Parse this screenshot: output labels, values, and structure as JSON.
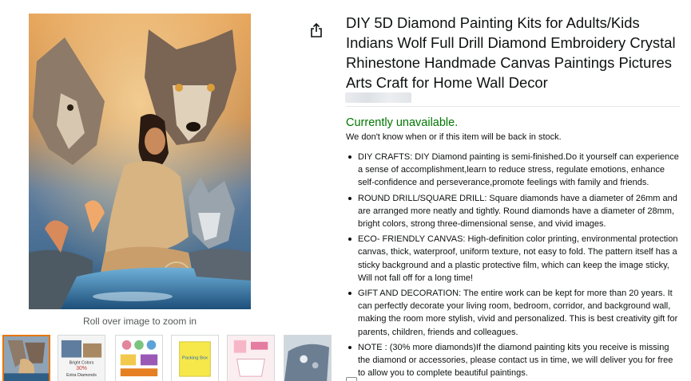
{
  "product": {
    "title": "DIY 5D Diamond Painting Kits for Adults/Kids Indians Wolf Full Drill Diamond Embroidery Crystal Rhinestone Handmade Canvas Paintings Pictures Arts Craft for Home Wall Decor",
    "availability": "Currently unavailable.",
    "availability_note": "We don't know when or if this item will be back in stock.",
    "bullets": [
      "DIY CRAFTS: DIY Diamond painting is semi-finished.Do it yourself can experience a sense of accomplishment,learn to reduce stress, regulate emotions, enhance self-confidence and perseverance,promote feelings with family and friends.",
      "ROUND DRILL/SQUARE DRILL: Square diamonds have a diameter of 26mm and are arranged more neatly and tightly. Round diamonds have a diameter of 28mm, bright colors, strong three-dimensional sense, and vivid images.",
      "ECO- FRIENDLY CANVAS: High-definition color printing, environmental protection canvas, thick, waterproof, uniform texture, not easy to fold. The pattern itself has a sticky background and a plastic protective film, which can keep the image sticky, Will not fall off for a long time!",
      "GIFT AND DECORATION: The entire work can be kept for more than 20 years. It can perfectly decorate your living room, bedroom, corridor, and background wall, making the room more stylish, vivid and personalized. This is best creativity gift for parents, children, friends and colleagues.",
      "NOTE : (30% more diamonds)If the diamond painting kits you receive is missing the diamond or accessories, please contact us in time, we will deliver you for free to allow you to complete beautiful paintings."
    ]
  },
  "gallery": {
    "zoom_hint": "Roll over image to zoom in",
    "thumbnails": [
      {
        "label": "main image",
        "selected": true
      },
      {
        "label": "Bright Colors 30% Extra Diamonds",
        "text_lines": [
          "Bright Colors",
          "30%",
          "Extra Diamonds"
        ]
      },
      {
        "label": "drill samples"
      },
      {
        "label": "Packing box",
        "text_lines": [
          "Packing Box"
        ]
      },
      {
        "label": "tools"
      },
      {
        "label": "detail"
      }
    ]
  },
  "icons": {
    "share": "share-icon"
  },
  "colors": {
    "availability": "#007600",
    "selected_thumb_border": "#e77600",
    "text": "#0f1111",
    "muted": "#565959"
  }
}
